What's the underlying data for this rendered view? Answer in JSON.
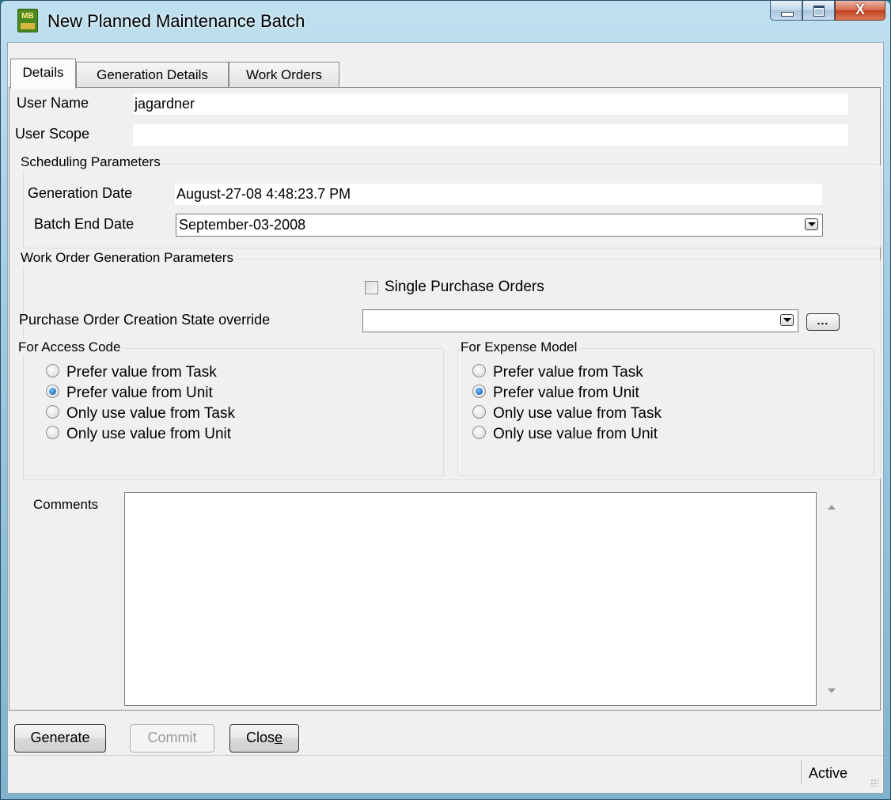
{
  "window": {
    "title": "New Planned Maintenance Batch",
    "icon_label": "MB",
    "close_glyph": "X"
  },
  "tabs": [
    {
      "label": "Details",
      "active": true
    },
    {
      "label": "Generation Details",
      "active": false
    },
    {
      "label": "Work Orders",
      "active": false
    }
  ],
  "details": {
    "user_name_label": "User Name",
    "user_name_value": "jagardner",
    "user_scope_label": "User Scope",
    "user_scope_value": ""
  },
  "scheduling": {
    "legend": "Scheduling Parameters",
    "generation_date_label": "Generation Date",
    "generation_date_value": "August-27-08 4:48:23.7 PM",
    "batch_end_date_label": "Batch End Date",
    "batch_end_date_value": "September-03-2008"
  },
  "work_order_generation": {
    "legend": "Work Order Generation Parameters",
    "single_po_label": "Single Purchase Orders",
    "single_po_checked": false,
    "po_state_label": "Purchase Order Creation State override",
    "po_state_value": "",
    "ellipsis_label": "...",
    "access_code": {
      "legend": "For Access Code",
      "options": [
        {
          "label": "Prefer value from Task",
          "selected": false
        },
        {
          "label": "Prefer value from Unit",
          "selected": true
        },
        {
          "label": "Only use value from Task",
          "selected": false
        },
        {
          "label": "Only use value from Unit",
          "selected": false
        }
      ]
    },
    "expense_model": {
      "legend": "For Expense Model",
      "options": [
        {
          "label": "Prefer value from Task",
          "selected": false
        },
        {
          "label": "Prefer value from Unit",
          "selected": true
        },
        {
          "label": "Only use value from Task",
          "selected": false
        },
        {
          "label": "Only use value from Unit",
          "selected": false
        }
      ]
    }
  },
  "comments": {
    "label": "Comments",
    "value": ""
  },
  "buttons": {
    "generate": "Generate",
    "commit": "Commit",
    "close_prefix": "Clos",
    "close_mnemonic": "e"
  },
  "status": {
    "text": "Active"
  }
}
